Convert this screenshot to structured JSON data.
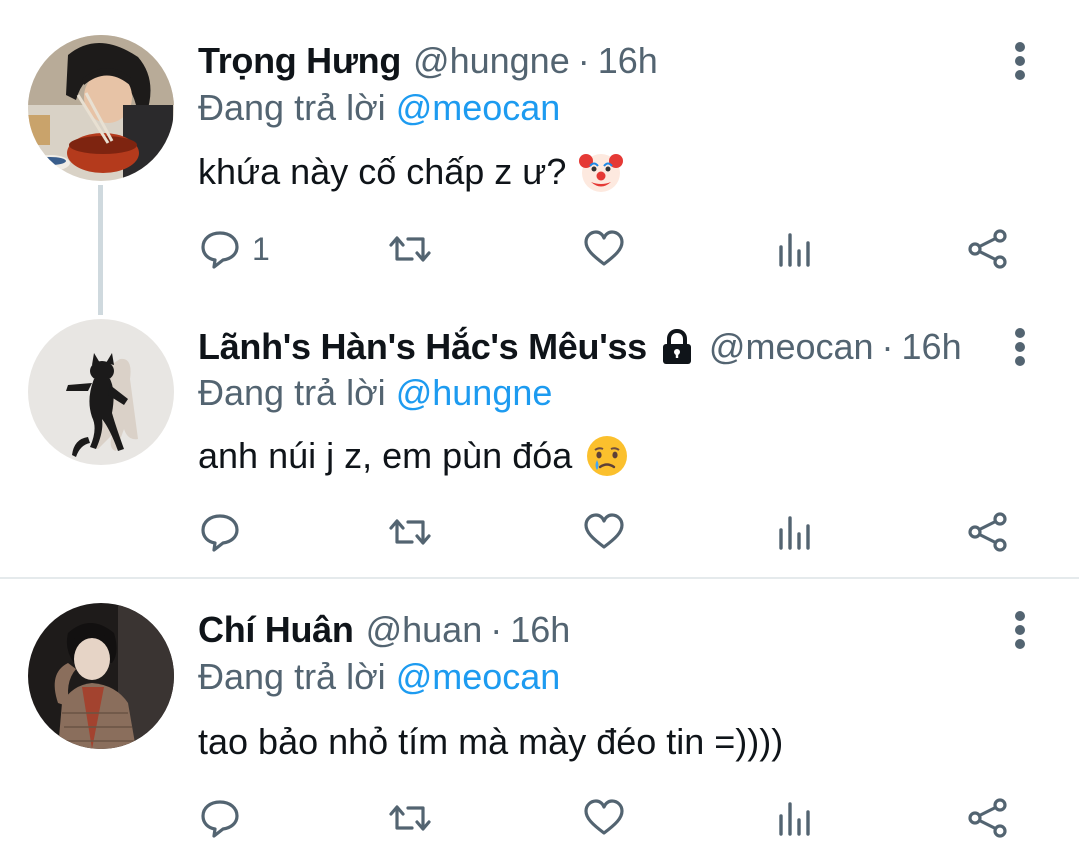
{
  "icons": {
    "reply": "reply-icon",
    "retweet": "retweet-icon",
    "like": "heart-icon",
    "views": "analytics-icon",
    "share": "share-icon",
    "more": "more-vertical-icon",
    "lock": "lock-icon"
  },
  "colors": {
    "name": "#0f1419",
    "muted": "#536471",
    "mention": "#1d9bf0",
    "thread_line": "#cfd9de"
  },
  "tweets": [
    {
      "name": "Trọng Hưng",
      "handle": "@hungne",
      "dot": "·",
      "time": "16h",
      "reply_prefix": "Đang trả lời",
      "reply_to": "@meocan",
      "text": "khứa này cố chấp z ư?",
      "emoji": "clown-face-emoji",
      "reply_count": "1",
      "protected": false
    },
    {
      "name": "Lãnh's Hàn's Hắc's Mêu'ss",
      "handle": "@meocan",
      "dot": "·",
      "time": "16h",
      "reply_prefix": "Đang trả lời",
      "reply_to": "@hungne",
      "text": "anh núi j z, em pùn đóa",
      "emoji": "crying-face-emoji",
      "reply_count": "",
      "protected": true
    },
    {
      "name": "Chí Huân",
      "handle": "@huan",
      "dot": "·",
      "time": "16h",
      "reply_prefix": "Đang trả lời",
      "reply_to": "@meocan",
      "text": "tao bảo nhỏ tím mà mày đéo tin =))))",
      "emoji": "",
      "reply_count": "",
      "protected": false
    }
  ]
}
